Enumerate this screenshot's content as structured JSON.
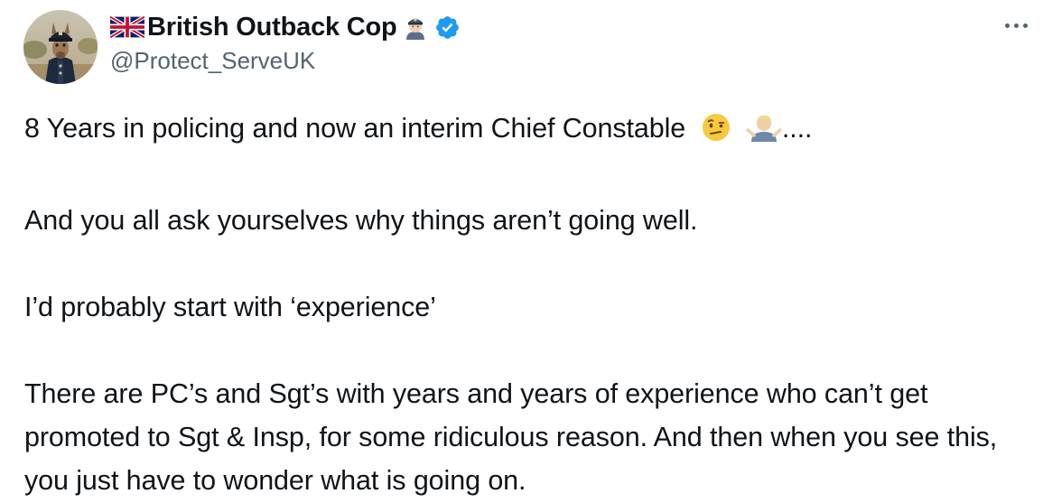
{
  "author": {
    "display_name": "British Outback Cop",
    "handle": "@Protect_ServeUK",
    "verified": true,
    "avatar_icon": "kangaroo-police-officer-avatar",
    "name_prefix_icon": "uk-flag-icon",
    "name_suffix_icon": "police-officer-emoji"
  },
  "menu": {
    "icon": "more-horizontal-icon"
  },
  "tweet": {
    "line1_text": "8 Years in policing and now an interim Chief Constable",
    "line1_emojis": [
      "face-with-raised-eyebrow-emoji",
      "person-shrugging-emoji"
    ],
    "line1_suffix": "....",
    "para2": "And you all ask yourselves why things aren’t going well.",
    "para3": "I’d probably start with ‘experience’",
    "para4": "There are PC’s and Sgt’s with years and years of experience who can’t get promoted to Sgt & Insp, for some ridiculous reason. And then when you see this, you just have to wonder what is going on."
  },
  "colors": {
    "text": "#0f1419",
    "secondary": "#536471",
    "verified_badge": "#1d9bf0"
  }
}
